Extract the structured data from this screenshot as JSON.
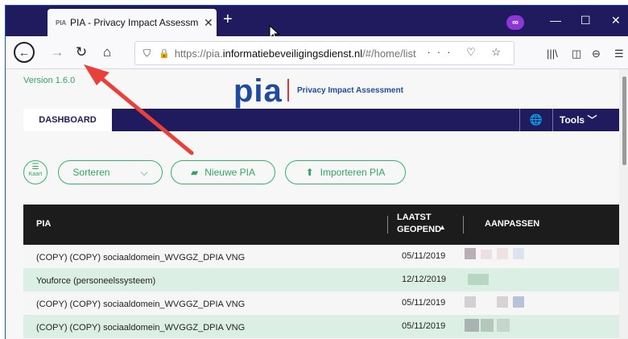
{
  "browser": {
    "tab_title": "PIA - Privacy Impact Assessment",
    "tab_favicon": "PIA",
    "url_prefix": "https://pia.",
    "url_domain": "informatiebeveiligingsdienst.nl",
    "url_suffix": "/#/home/list",
    "url_actions": "··· ♡ ☆",
    "icons": [
      "back-icon",
      "forward-icon",
      "reload-icon",
      "home-icon",
      "shield-icon",
      "lock-icon",
      "library-icon",
      "sidebar-icon",
      "account-icon",
      "menu-icon",
      "private-mask-icon",
      "minimize-icon",
      "maximize-icon",
      "close-icon"
    ]
  },
  "app": {
    "version": "Version 1.6.0",
    "logo": "pia",
    "logo_subtitle": "Privacy Impact Assessment",
    "menu": {
      "dashboard": "DASHBOARD",
      "tools": "Tools"
    },
    "toolbar": {
      "view_toggle": "Kaart",
      "sort": "Sorteren",
      "new": "Nieuwe PIA",
      "import": "Importeren PIA"
    },
    "table": {
      "headers": {
        "pia": "PIA",
        "last_opened_1": "LAATST",
        "last_opened_2": "GEOPEND",
        "edit": "AANPASSEN"
      },
      "rows": [
        {
          "name": "(COPY) (COPY) sociaaldomein_WVGGZ_DPIA VNG",
          "date": "05/11/2019"
        },
        {
          "name": "Youforce (personeelssysteem)",
          "date": "12/12/2019"
        },
        {
          "name": "(COPY) (COPY) sociaaldomein_WVGGZ_DPIA VNG",
          "date": "05/11/2019"
        },
        {
          "name": "(COPY) (COPY) sociaaldomein_WVGGZ_DPIA VNG",
          "date": "05/11/2019"
        }
      ]
    }
  },
  "colors": {
    "brand_navy": "#1f1b5e",
    "accent_green": "#2fa764",
    "logo_blue": "#1f4aa0",
    "arrow_red": "#e8413b"
  }
}
